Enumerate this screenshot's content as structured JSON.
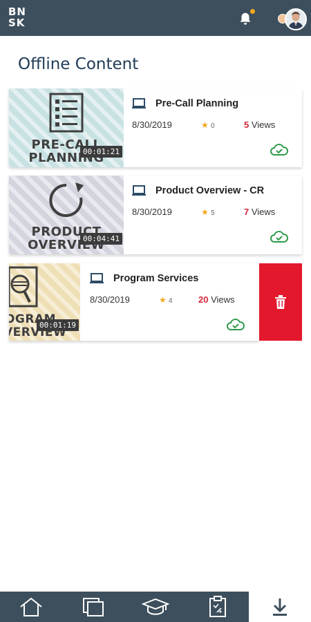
{
  "header": {
    "logo_line1": "BN",
    "logo_line2": "SK"
  },
  "page": {
    "title": "Offline Content"
  },
  "cards": [
    {
      "thumb_text_line1": "PRE-CALL",
      "thumb_text_line2": "PLANNING",
      "duration": "00:01:21",
      "title": "Pre-Call Planning",
      "date": "8/30/2019",
      "rating": "0",
      "views_count": "5",
      "views_label": "Views"
    },
    {
      "thumb_text_line1": "PRODUCT",
      "thumb_text_line2": "OVERVIEW",
      "duration": "00:04:41",
      "title": "Product Overview - CR",
      "date": "8/30/2019",
      "rating": "5",
      "views_count": "7",
      "views_label": "Views"
    },
    {
      "thumb_text_line1": "OGRAM",
      "thumb_text_line2": "VERVIEW",
      "duration": "00:01:19",
      "title": "Program Services",
      "date": "8/30/2019",
      "rating": "4",
      "views_count": "20",
      "views_label": "Views"
    }
  ],
  "colors": {
    "header_bg": "#3d4f5c",
    "accent_red": "#e3182d",
    "views_red": "#d4283a",
    "star": "#f2a81d",
    "cloud_green": "#2e9a4a"
  },
  "icons": {
    "bell": "bell-icon",
    "delete": "trash-icon",
    "offline": "cloud-check-icon",
    "device": "laptop-icon"
  },
  "nav": {
    "active": "downloads"
  }
}
